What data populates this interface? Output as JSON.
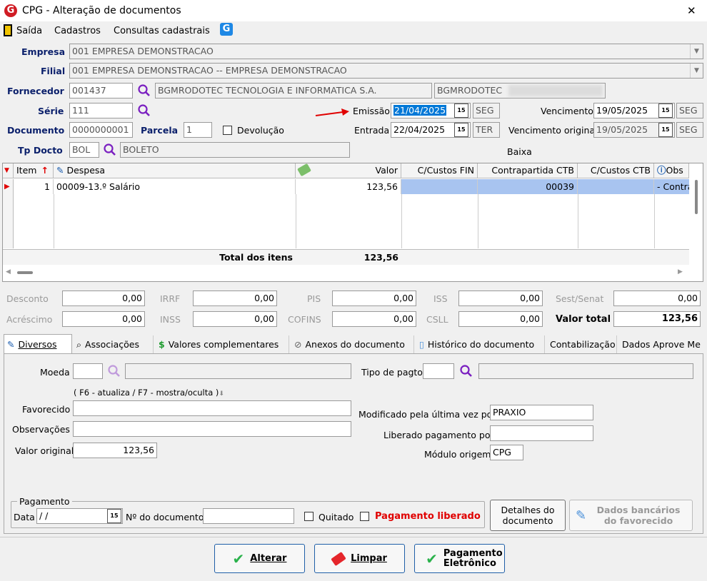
{
  "window": {
    "title": "CPG - Alteração de documentos",
    "close": "✕"
  },
  "menu": {
    "items": [
      "Saída",
      "Cadastros",
      "Consultas cadastrais"
    ]
  },
  "header": {
    "empresa_label": "Empresa",
    "empresa_value": "001 EMPRESA DEMONSTRACAO",
    "filial_label": "Filial",
    "filial_value": "001 EMPRESA DEMONSTRACAO -- EMPRESA DEMONSTRACAO",
    "fornecedor_label": "Fornecedor",
    "fornecedor_code": "001437",
    "fornecedor_name": "BGMRODOTEC TECNOLOGIA E INFORMATICA S.A.",
    "fornecedor_short": "BGMRODOTEC",
    "serie_label": "Série",
    "serie_value": "111",
    "documento_label": "Documento",
    "documento_value": "0000000001",
    "parcela_label": "Parcela",
    "parcela_value": "1",
    "devolucao_label": "Devolução",
    "tpdocto_label": "Tp Docto",
    "tpdocto_code": "BOL",
    "tpdocto_name": "BOLETO",
    "emissao_label": "Emissão",
    "emissao_value": "21/04/2025",
    "emissao_dow": "SEG",
    "entrada_label": "Entrada",
    "entrada_value": "22/04/2025",
    "entrada_dow": "TER",
    "vencimento_label": "Vencimento",
    "vencimento_value": "19/05/2025",
    "vencimento_dow": "SEG",
    "venc_orig_label": "Vencimento original",
    "venc_orig_value": "19/05/2025",
    "venc_orig_dow": "SEG",
    "baixa_label": "Baixa",
    "cal_glyph": "15"
  },
  "grid": {
    "columns": [
      "Item",
      "Despesa",
      "Valor",
      "C/Custos FIN",
      "Contrapartida CTB",
      "C/Custos CTB",
      "Obs"
    ],
    "rows": [
      {
        "item": "1",
        "despesa": "00009-13.º Salário",
        "valor": "123,56",
        "ccfin": "",
        "contrapartida": "00039",
        "ccctb": "",
        "obs": "- Contra"
      }
    ],
    "total_label": "Total dos itens",
    "total_value": "123,56"
  },
  "totals": {
    "desconto_label": "Desconto",
    "desconto": "0,00",
    "irrf_label": "IRRF",
    "irrf": "0,00",
    "pis_label": "PIS",
    "pis": "0,00",
    "iss_label": "ISS",
    "iss": "0,00",
    "sest_label": "Sest/Senat",
    "sest": "0,00",
    "acrescimo_label": "Acréscimo",
    "acrescimo": "0,00",
    "inss_label": "INSS",
    "inss": "0,00",
    "cofins_label": "COFINS",
    "cofins": "0,00",
    "csll_label": "CSLL",
    "csll": "0,00",
    "valor_total_label": "Valor total",
    "valor_total": "123,56"
  },
  "tabs": [
    "Diversos",
    "Associações",
    "Valores complementares",
    "Anexos do documento",
    "Histórico do documento",
    "Contabilização",
    "Dados Aprove Me"
  ],
  "diversos": {
    "moeda_label": "Moeda",
    "tipo_pagto_label": "Tipo de pagto",
    "hint": "( F6 - atualiza / F7 - mostra/oculta )",
    "favorecido_label": "Favorecido",
    "observacoes_label": "Observações",
    "valor_original_label": "Valor original",
    "valor_original": "123,56",
    "modificado_label": "Modificado pela última vez por",
    "modificado_value": "PRAXIO",
    "liberado_label": "Liberado pagamento por",
    "liberado_value": "",
    "modulo_label": "Módulo origem",
    "modulo_value": "CPG",
    "pagamento_group": "Pagamento",
    "data_label": "Data",
    "data_value": " /  /",
    "ndoc_label": "Nº do documento",
    "quitado_label": "Quitado",
    "pag_liberado_label": "Pagamento liberado",
    "detalhes_btn": "Detalhes do documento",
    "dados_bancarios_btn": "Dados bancários do favorecido"
  },
  "footer": {
    "alterar": "Alterar",
    "limpar": "Limpar",
    "pagamento": "Pagamento Eletrônico"
  },
  "colors": {
    "label_blue": "#0a1f6b",
    "selection": "#0078d7",
    "row_highlight": "#a8c4f0",
    "red": "#e00000",
    "purple": "#7a1fc0"
  }
}
